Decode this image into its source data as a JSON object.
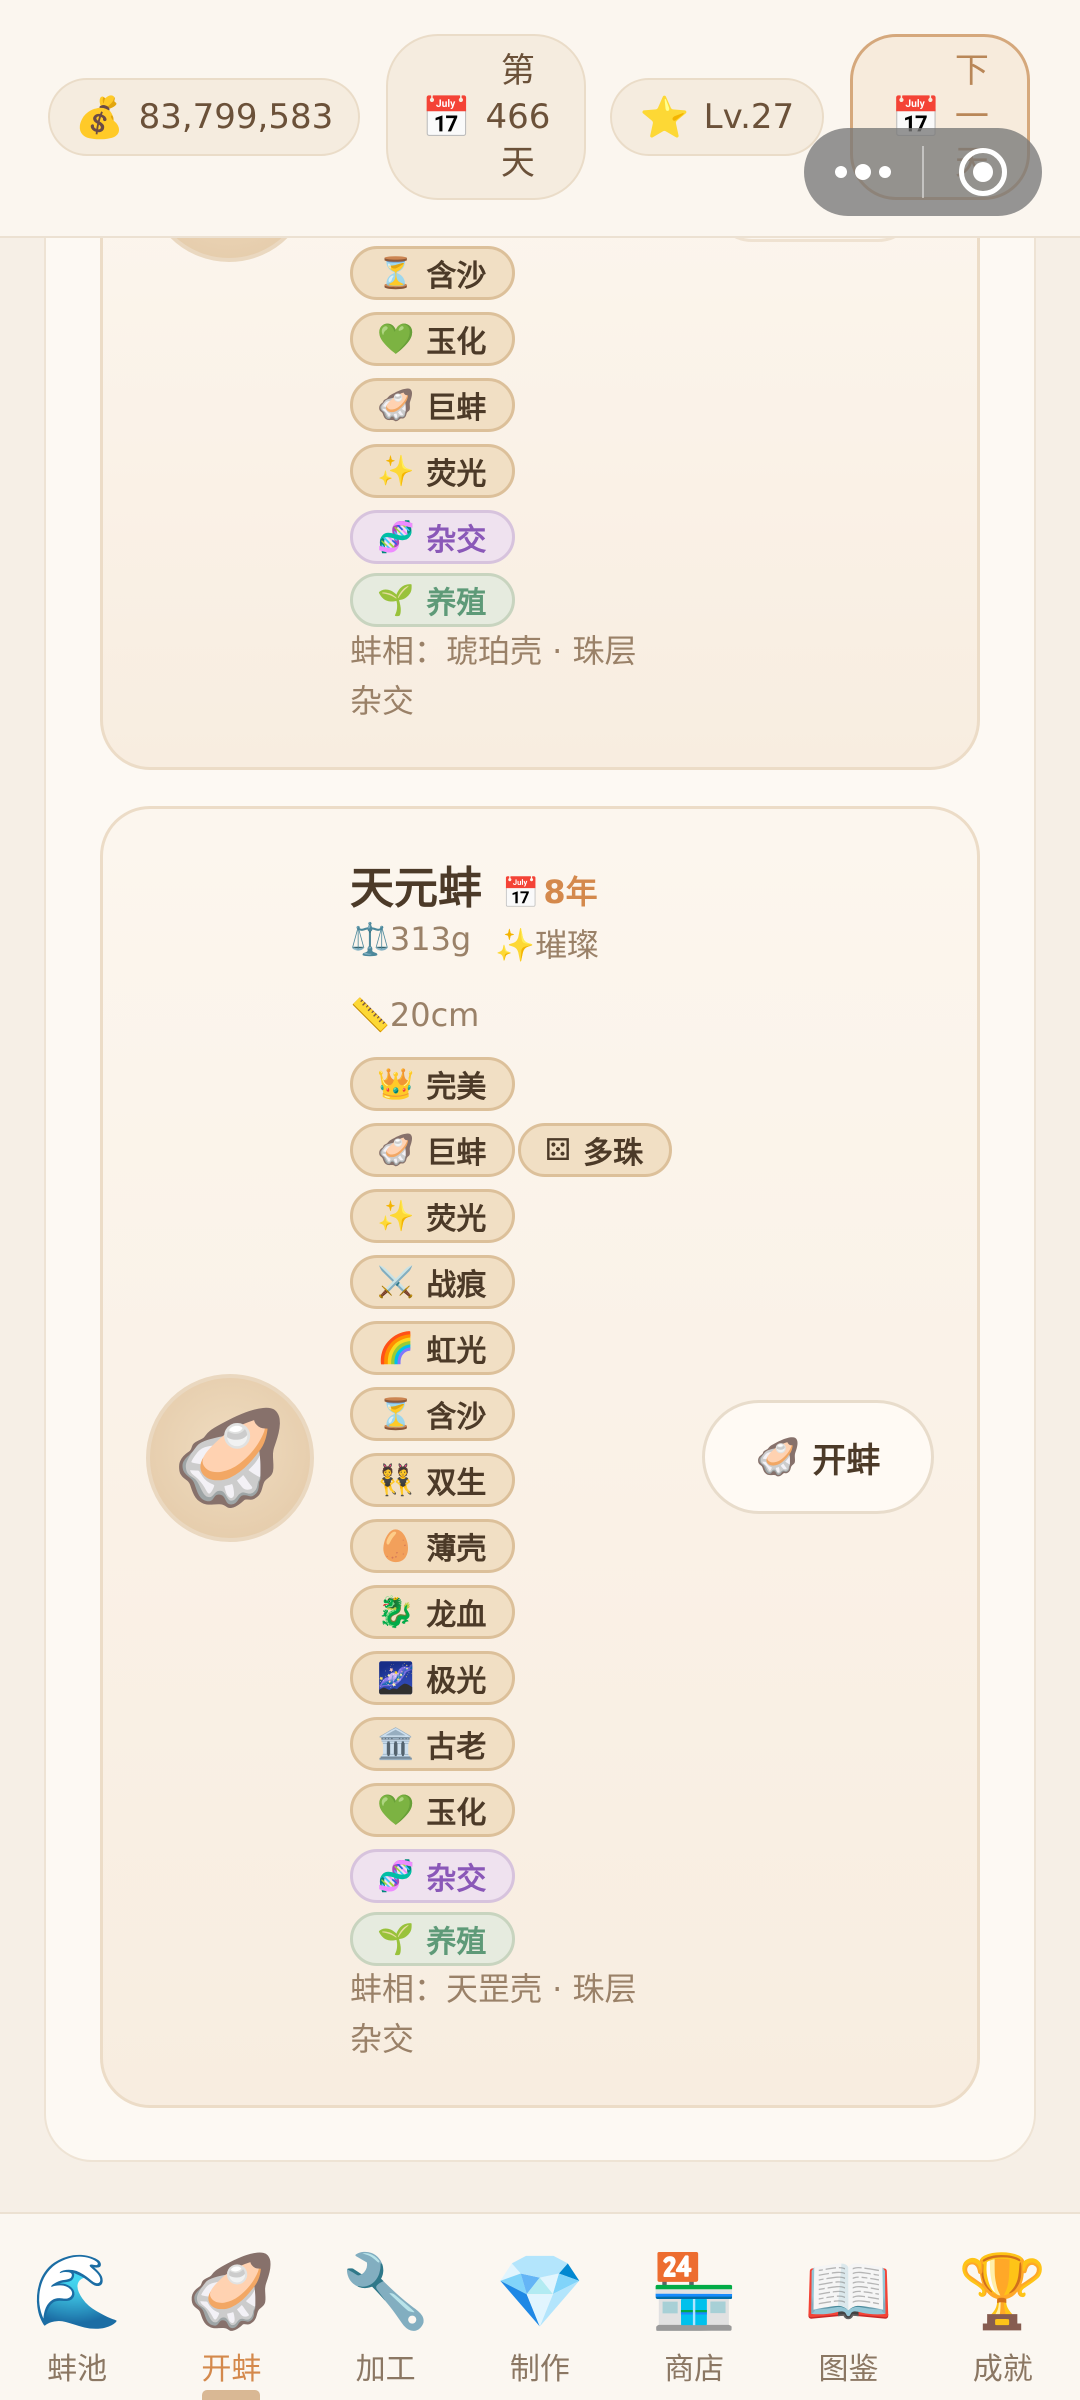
{
  "topbar": {
    "money": {
      "icon": "💰",
      "value": "83,799,583"
    },
    "day": {
      "icon": "📅",
      "line1": "第",
      "line2": "466",
      "line3": "天"
    },
    "level": {
      "icon": "⭐",
      "value": "Lv.27"
    },
    "next_day": {
      "icon": "📅",
      "line1": "下",
      "line2": "一",
      "line3": "天"
    }
  },
  "card1": {
    "avatar_icon": "🦪",
    "tags": [
      {
        "icon": "⏳",
        "label": "含沙"
      },
      {
        "icon": "💚",
        "label": "玉化"
      },
      {
        "icon": "🦪",
        "label": "巨蚌"
      },
      {
        "icon": "✨",
        "label": "荧光"
      },
      {
        "icon": "🧬",
        "label": "杂交"
      },
      {
        "icon": "🌱",
        "label": "养殖"
      }
    ],
    "appearance_line1": "蚌相：琥珀壳 · 珠层",
    "appearance_line2": "杂交"
  },
  "card2": {
    "name": "天元蚌",
    "age_icon": "📅",
    "age": "8年",
    "weight": "⚖️313g",
    "quality": "✨璀璨",
    "length": "📏20cm",
    "avatar_icon": "🦪",
    "tags": [
      {
        "icon": "👑",
        "label": "完美"
      },
      {
        "icon": "🦪",
        "label": "巨蚌"
      },
      {
        "icon": "⚄",
        "label": "多珠"
      },
      {
        "icon": "✨",
        "label": "荧光"
      },
      {
        "icon": "⚔️",
        "label": "战痕"
      },
      {
        "icon": "🌈",
        "label": "虹光"
      },
      {
        "icon": "⏳",
        "label": "含沙"
      },
      {
        "icon": "👯",
        "label": "双生"
      },
      {
        "icon": "🥚",
        "label": "薄壳"
      },
      {
        "icon": "🐉",
        "label": "龙血"
      },
      {
        "icon": "🌌",
        "label": "极光"
      },
      {
        "icon": "🏛️",
        "label": "古老"
      },
      {
        "icon": "💚",
        "label": "玉化"
      },
      {
        "icon": "🧬",
        "label": "杂交"
      },
      {
        "icon": "🌱",
        "label": "养殖"
      }
    ],
    "appearance_line1": "蚌相：天罡壳 · 珠层",
    "appearance_line2": "杂交",
    "open_button": {
      "icon": "🦪",
      "label": "开蚌"
    }
  },
  "nav": [
    {
      "icon": "🌊",
      "label": "蚌池"
    },
    {
      "icon": "🦪",
      "label": "开蚌",
      "active": true
    },
    {
      "icon": "🔧",
      "label": "加工"
    },
    {
      "icon": "💎",
      "label": "制作"
    },
    {
      "icon": "🏪",
      "label": "商店"
    },
    {
      "icon": "📖",
      "label": "图鉴"
    },
    {
      "icon": "🏆",
      "label": "成就"
    }
  ]
}
